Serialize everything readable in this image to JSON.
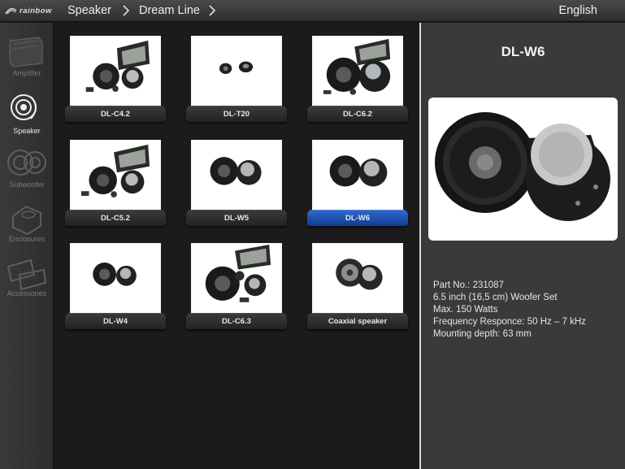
{
  "header": {
    "logo_text": "rainbow",
    "breadcrumb": [
      "Speaker",
      "Dream Line"
    ],
    "language": "English"
  },
  "sidebar": {
    "items": [
      {
        "label": "Amplifier",
        "icon": "amplifier-icon",
        "active": false
      },
      {
        "label": "Speaker",
        "icon": "speaker-icon",
        "active": true
      },
      {
        "label": "Subwoofer",
        "icon": "subwoofer-icon",
        "active": false
      },
      {
        "label": "Enclosures",
        "icon": "enclosure-icon",
        "active": false
      },
      {
        "label": "Accessories",
        "icon": "accessories-icon",
        "active": false
      }
    ]
  },
  "products": [
    {
      "label": "DL-C4.2",
      "selected": false
    },
    {
      "label": "DL-T20",
      "selected": false
    },
    {
      "label": "DL-C6.2",
      "selected": false
    },
    {
      "label": "DL-C5.2",
      "selected": false
    },
    {
      "label": "DL-W5",
      "selected": false
    },
    {
      "label": "DL-W6",
      "selected": true
    },
    {
      "label": "DL-W4",
      "selected": false
    },
    {
      "label": "DL-C6.3",
      "selected": false
    },
    {
      "label": "Coaxial speaker",
      "selected": false
    }
  ],
  "detail": {
    "title": "DL-W6",
    "specs": [
      "Part No.: 231087",
      "6.5 inch (16,5 cm) Woofer Set",
      "Max. 150 Watts",
      "Frequency Responce: 50 Hz – 7 kHz",
      "Mounting depth: 63 mm"
    ]
  },
  "colors": {
    "accent": "#1f55b8",
    "background": "#1b1b1b",
    "panel": "#3a3a3a"
  }
}
